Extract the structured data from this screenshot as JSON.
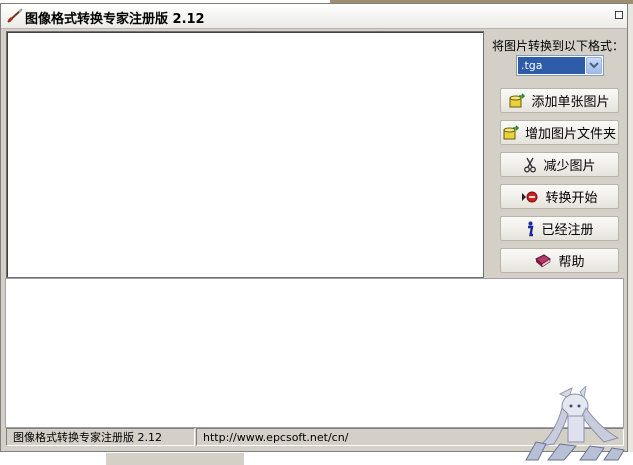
{
  "window": {
    "title": "图像格式转换专家注册版 2.12"
  },
  "panel": {
    "convert_label": "将图片转换到以下格式：",
    "format_selected": ".tga",
    "buttons": [
      {
        "label": "添加单张图片",
        "icon": "add-image-icon"
      },
      {
        "label": "增加图片文件夹",
        "icon": "add-folder-icon"
      },
      {
        "label": "减少图片",
        "icon": "scissors-icon"
      },
      {
        "label": "转换开始",
        "icon": "record-icon"
      },
      {
        "label": "已经注册",
        "icon": "info-icon"
      },
      {
        "label": "帮助",
        "icon": "help-book-icon"
      }
    ]
  },
  "status": {
    "app_name": "图像格式转换专家注册版 2.12",
    "url": "http://www.epcsoft.net/cn/"
  },
  "colors": {
    "window_bg": "#d4d0c8",
    "selection": "#2f5ca8"
  }
}
